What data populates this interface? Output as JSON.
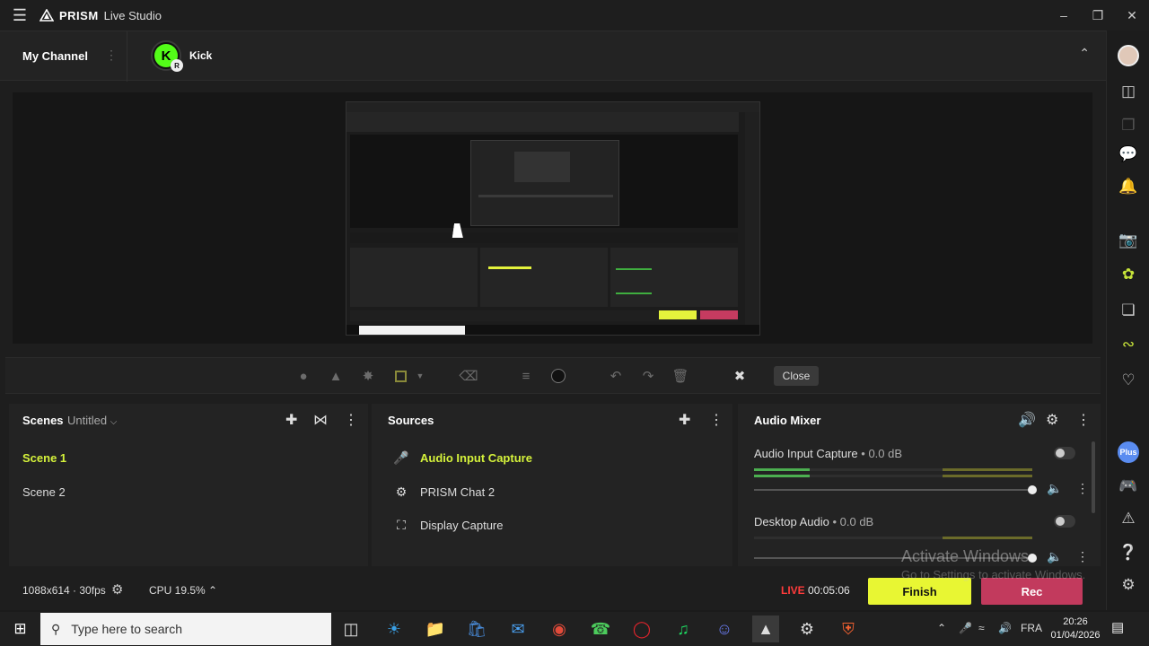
{
  "window": {
    "app_name_bold": "PRISM",
    "app_name_light": "Live Studio"
  },
  "channel_bar": {
    "title": "My Channel",
    "channel_name": "Kick",
    "channel_badge": "R"
  },
  "toolbar": {
    "close_label": "Close"
  },
  "scenes": {
    "title": "Scenes",
    "collection": "Untitled",
    "items": [
      {
        "label": "Scene 1",
        "active": true
      },
      {
        "label": "Scene 2",
        "active": false
      }
    ]
  },
  "sources": {
    "title": "Sources",
    "items": [
      {
        "label": "Audio Input Capture",
        "icon": "microphone-icon",
        "active": true
      },
      {
        "label": "PRISM Chat 2",
        "icon": "chat-icon",
        "active": false
      },
      {
        "label": "Display Capture",
        "icon": "display-capture-icon",
        "active": false
      }
    ]
  },
  "audio_mixer": {
    "title": "Audio Mixer",
    "channels": [
      {
        "name": "Audio Input Capture",
        "db": "0.0 dB",
        "level": 0.2,
        "volume": 1.0
      },
      {
        "name": "Desktop Audio",
        "db": "0.0 dB",
        "level": 0.0,
        "volume": 1.0
      }
    ]
  },
  "status": {
    "resolution": "1088x614 · 30fps",
    "cpu": "CPU 19.5%",
    "live_label": "LIVE",
    "live_time": "00:05:06",
    "finish_label": "Finish",
    "rec_label": "Rec"
  },
  "watermark": {
    "line1": "Activate Windows",
    "line2": "Go to Settings to activate Windows."
  },
  "taskbar": {
    "search_placeholder": "Type here to search",
    "language": "FRA",
    "time": "20:26",
    "date": "01/04/2026"
  },
  "colors": {
    "accent_yellow": "#e8f633",
    "rec_red": "#c23a5d",
    "live_red": "#ff3b3b",
    "kick_green": "#53fc18"
  }
}
